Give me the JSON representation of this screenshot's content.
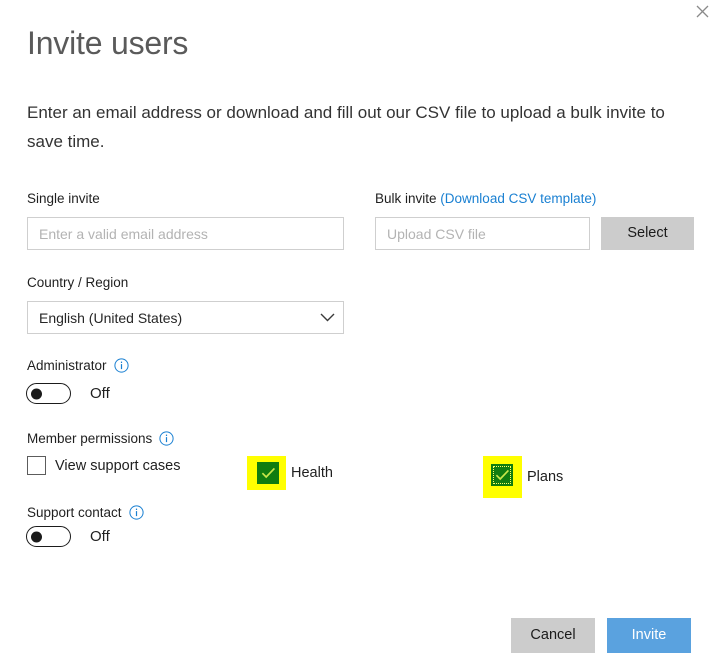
{
  "dialog": {
    "title": "Invite users",
    "description": "Enter an email address or download and fill out our CSV file to upload a bulk invite to save time.",
    "close_icon": "close-icon"
  },
  "single_invite": {
    "label": "Single invite",
    "placeholder": "Enter a valid email address",
    "value": ""
  },
  "bulk_invite": {
    "label": "Bulk invite",
    "link_text": "(Download CSV template)",
    "placeholder": "Upload CSV file",
    "value": "",
    "select_button": "Select"
  },
  "country": {
    "label": "Country / Region",
    "selected": "English (United States)",
    "chevron_icon": "chevron-down-icon"
  },
  "administrator": {
    "label": "Administrator",
    "info_icon": "info-icon",
    "state": "Off"
  },
  "member_permissions": {
    "label": "Member permissions",
    "info_icon": "info-icon",
    "checkboxes": [
      {
        "name": "view-support-cases",
        "label": "View support cases",
        "checked": false,
        "highlighted": false,
        "focused": false
      },
      {
        "name": "health",
        "label": "Health",
        "checked": true,
        "highlighted": true,
        "focused": false
      },
      {
        "name": "plans",
        "label": "Plans",
        "checked": true,
        "highlighted": true,
        "focused": true
      }
    ]
  },
  "support_contact": {
    "label": "Support contact",
    "info_icon": "info-icon",
    "state": "Off"
  },
  "footer": {
    "cancel_label": "Cancel",
    "invite_label": "Invite"
  },
  "colors": {
    "accent_blue": "#5aa2df",
    "link_blue": "#1a80d2",
    "checked_green": "#107c10",
    "highlight_yellow": "#ffff00",
    "button_gray": "#cccccc"
  }
}
